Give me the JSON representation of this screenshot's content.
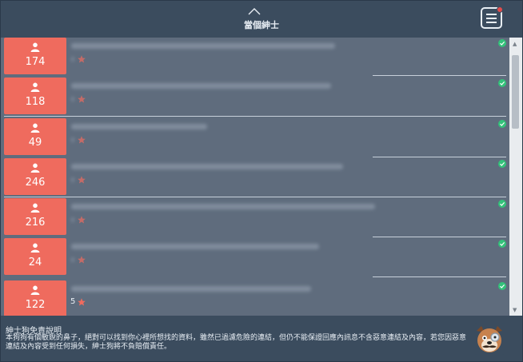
{
  "header": {
    "title": "當個紳士",
    "menu_icon": "hamburger-menu-icon"
  },
  "rows": [
    {
      "count": "174"
    },
    {
      "count": "118"
    },
    {
      "count": "49"
    },
    {
      "count": "246"
    },
    {
      "count": "216"
    },
    {
      "count": "24"
    },
    {
      "count": "122",
      "rating": "5"
    }
  ],
  "footer": {
    "title": "紳士狗免責說明",
    "text": "本狗狗有個敏銳的鼻子，絕對可以找到你心裡所想找的資料，雖然已過濾危險的連結，但仍不能保證回應內訊息不含惡意連結及內容，若您因惡意連結及內容受到任何損失，紳士狗將不負賠償責任。"
  },
  "colors": {
    "header_bg": "#3b4c5e",
    "list_bg": "#5f6c7d",
    "vote_bg": "#ef6b5e",
    "check": "#33c27a",
    "star": "#ef6b5e"
  }
}
